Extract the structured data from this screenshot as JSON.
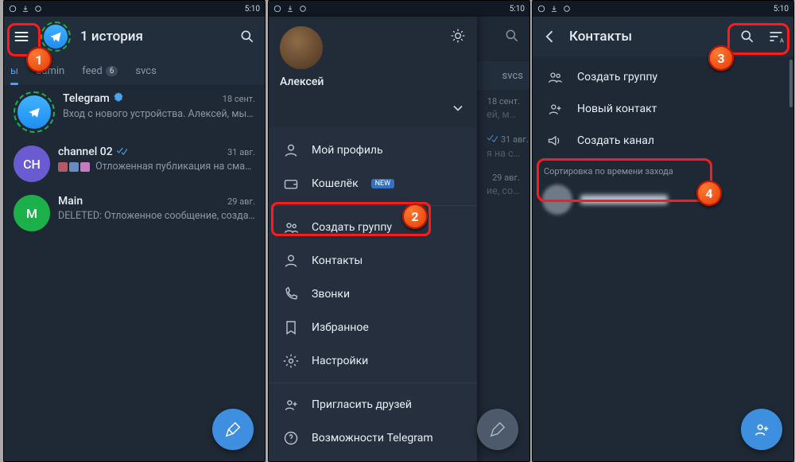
{
  "status": {
    "time": "5:10"
  },
  "screen1": {
    "title": "1 история",
    "tabs": [
      {
        "label": "ы",
        "active": true
      },
      {
        "label": "admin",
        "active": false
      },
      {
        "label": "feed",
        "count": "6",
        "active": false
      },
      {
        "label": "svcs",
        "active": false
      }
    ],
    "chats": [
      {
        "name": "Telegram",
        "verified": true,
        "time": "18 сент.",
        "msg": "Вход с нового устройства. Алексей, мы обна…"
      },
      {
        "name": "channel 02",
        "initials": "CH",
        "color": "#6a5bd1",
        "time": "31 авг.",
        "read": true,
        "msg": "Отложенная публикация на смартфо…",
        "thumbs": true
      },
      {
        "name": "Main",
        "initials": "M",
        "color": "#1cb04b",
        "time": "29 авг.",
        "msg": "DELETED: Отложенное сообщение, созданное…"
      }
    ]
  },
  "drawer": {
    "profile_name": "Алексей",
    "items_top": [
      {
        "icon": "user",
        "label": "Мой профиль"
      },
      {
        "icon": "wallet",
        "label": "Кошелёк",
        "badge": "NEW"
      }
    ],
    "items_mid": [
      {
        "icon": "group",
        "label": "Создать группу"
      },
      {
        "icon": "contact",
        "label": "Контакты",
        "hl": true
      },
      {
        "icon": "phone",
        "label": "Звонки"
      },
      {
        "icon": "bookmark",
        "label": "Избранное"
      },
      {
        "icon": "settings",
        "label": "Настройки"
      }
    ],
    "items_bottom": [
      {
        "icon": "invite",
        "label": "Пригласить друзей"
      },
      {
        "icon": "help",
        "label": "Возможности Telegram"
      }
    ]
  },
  "screen3": {
    "title": "Контакты",
    "actions": [
      {
        "icon": "group",
        "label": "Создать группу"
      },
      {
        "icon": "new-contact",
        "label": "Новый контакт"
      },
      {
        "icon": "channel",
        "label": "Создать канал"
      }
    ],
    "sort_label": "Сортировка по времени захода",
    "contact_name": "██████"
  },
  "markers": {
    "m1": "1",
    "m2": "2",
    "m3": "3",
    "m4": "4"
  }
}
